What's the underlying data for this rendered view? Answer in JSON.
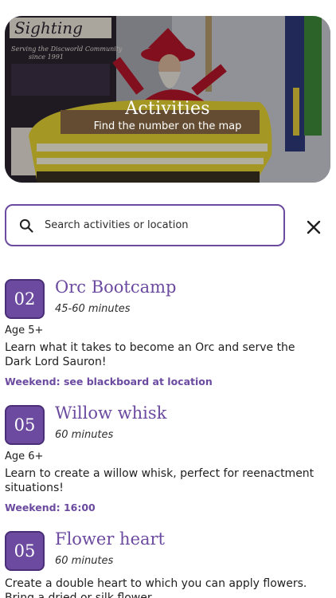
{
  "hero": {
    "title": "Activities",
    "subtitle": "Find the number on the map",
    "sign_text": "Sighting",
    "sign_lines": [
      "Serving the Discworld Community",
      "since 1991"
    ]
  },
  "search": {
    "placeholder": "Search activities or location",
    "value": ""
  },
  "icons": {
    "search": "search-icon",
    "clear": "close-icon"
  },
  "colors": {
    "accent": "#6b4aa0",
    "badge_border": "#4a2f78"
  },
  "activities": [
    {
      "number": "02",
      "title": "Orc Bootcamp",
      "duration": "45-60 minutes",
      "age": "Age 5+",
      "description": "Learn what it takes to become an Orc and serve the Dark Lord Sauron!",
      "weekend": "Weekend: see blackboard at location"
    },
    {
      "number": "05",
      "title": "Willow whisk",
      "duration": "60 minutes",
      "age": "Age 6+",
      "description": "Learn to create a willow whisk, perfect for reenactment situations!",
      "weekend": "Weekend: 16:00"
    },
    {
      "number": "05",
      "title": "Flower heart",
      "duration": "60 minutes",
      "description": "Create a double heart to which you can apply flowers. Bring a dried or silk flower."
    }
  ]
}
